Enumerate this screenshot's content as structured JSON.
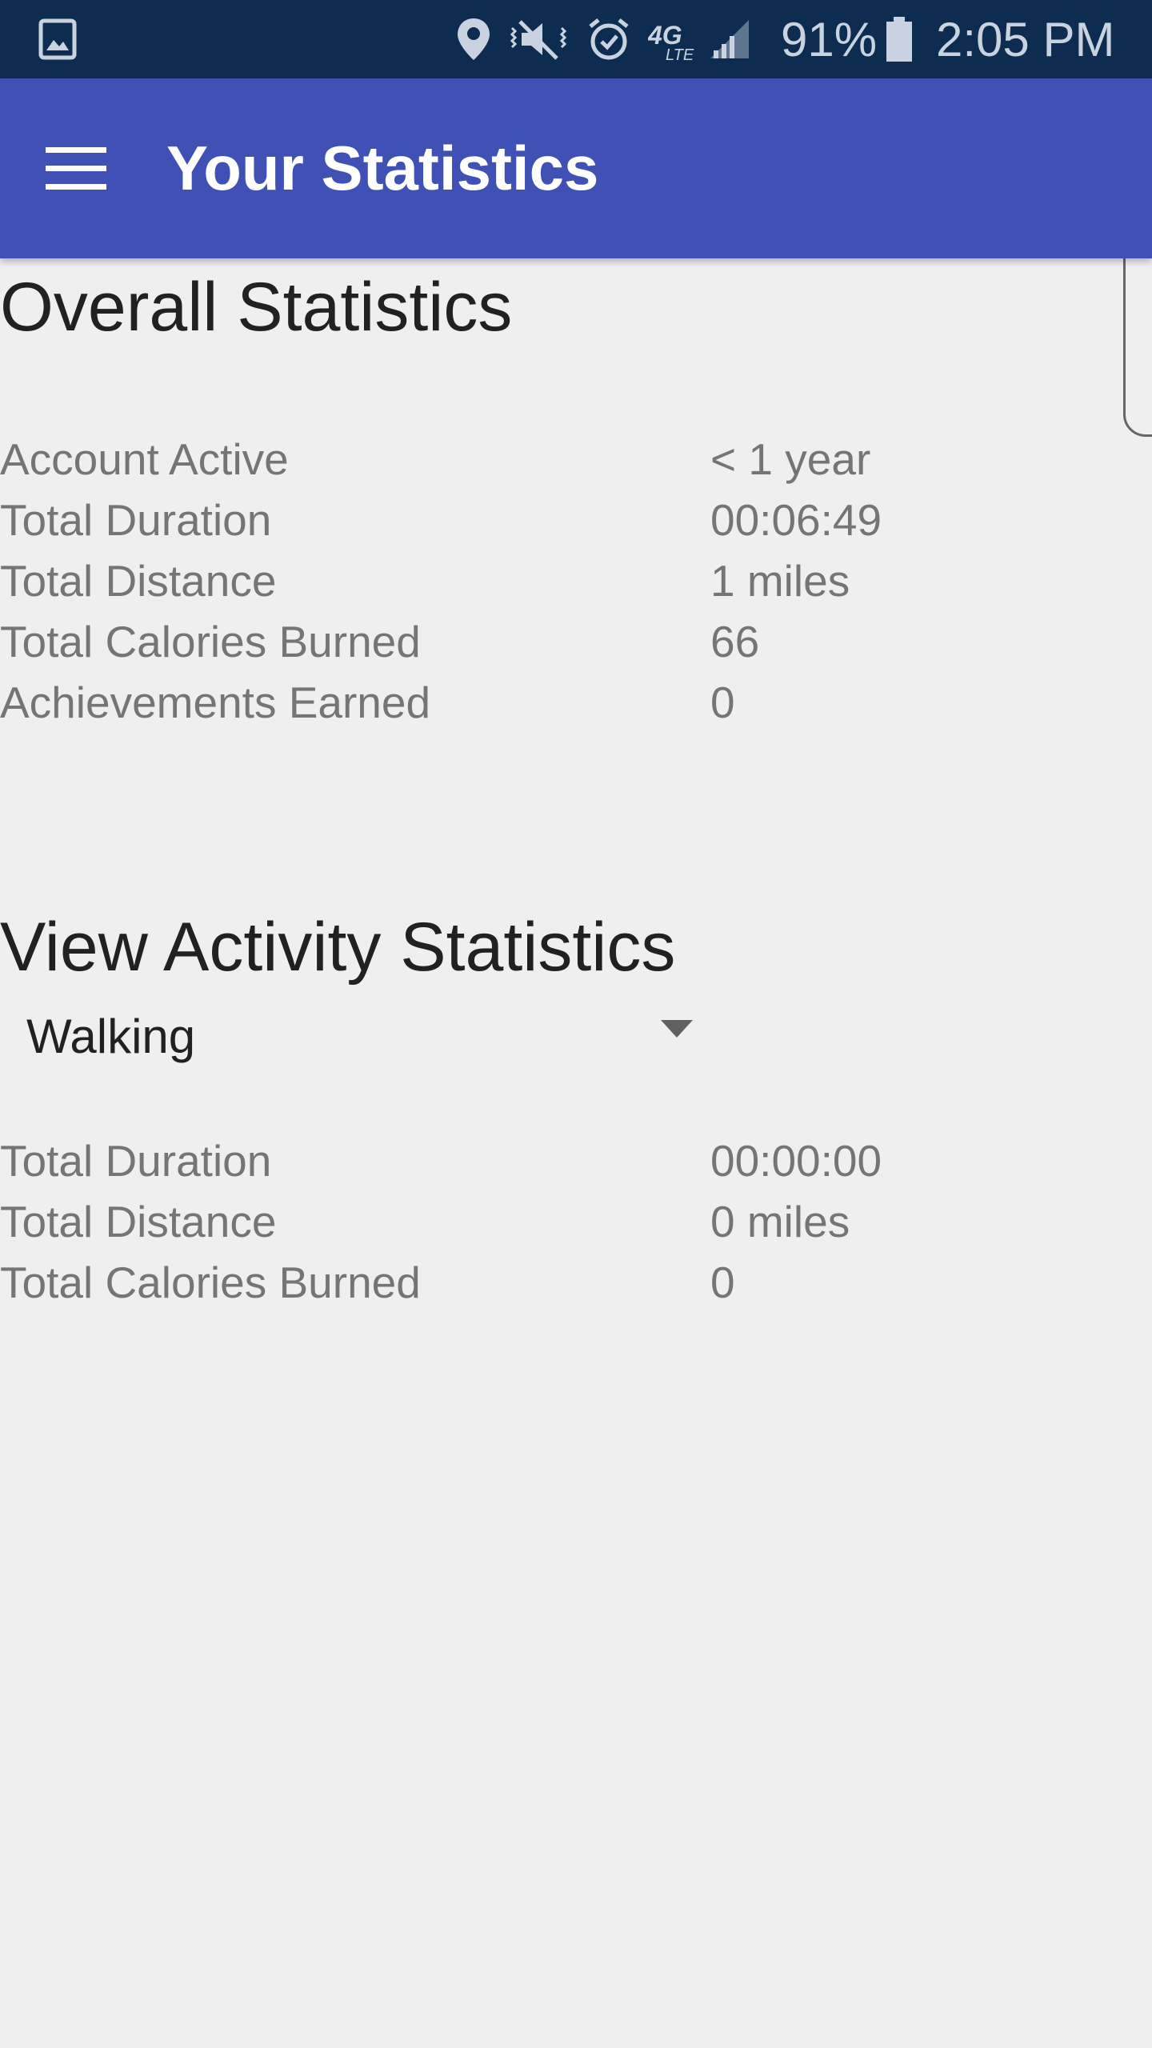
{
  "status_bar": {
    "battery_percent": "91%",
    "time": "2:05 PM",
    "network_label": "4G",
    "icons": [
      "gallery-icon",
      "location-icon",
      "vibrate-mute-icon",
      "alarm-icon",
      "4g-lte-icon",
      "signal-icon",
      "battery-icon"
    ]
  },
  "app_bar": {
    "title": "Your Statistics",
    "menu_icon": "hamburger-menu-icon",
    "background": "#3f51b5"
  },
  "overall": {
    "title": "Overall Statistics",
    "rows": [
      {
        "label": "Account Active",
        "value": "< 1 year"
      },
      {
        "label": "Total Duration",
        "value": "00:06:49"
      },
      {
        "label": "Total Distance",
        "value": "1 miles"
      },
      {
        "label": "Total Calories Burned",
        "value": "66"
      },
      {
        "label": "Achievements Earned",
        "value": "0"
      }
    ]
  },
  "activity": {
    "title": "View Activity Statistics",
    "selected_activity": "Walking",
    "rows": [
      {
        "label": "Total Duration",
        "value": "00:00:00"
      },
      {
        "label": "Total Distance",
        "value": "0 miles"
      },
      {
        "label": "Total Calories Burned",
        "value": "0"
      }
    ]
  }
}
